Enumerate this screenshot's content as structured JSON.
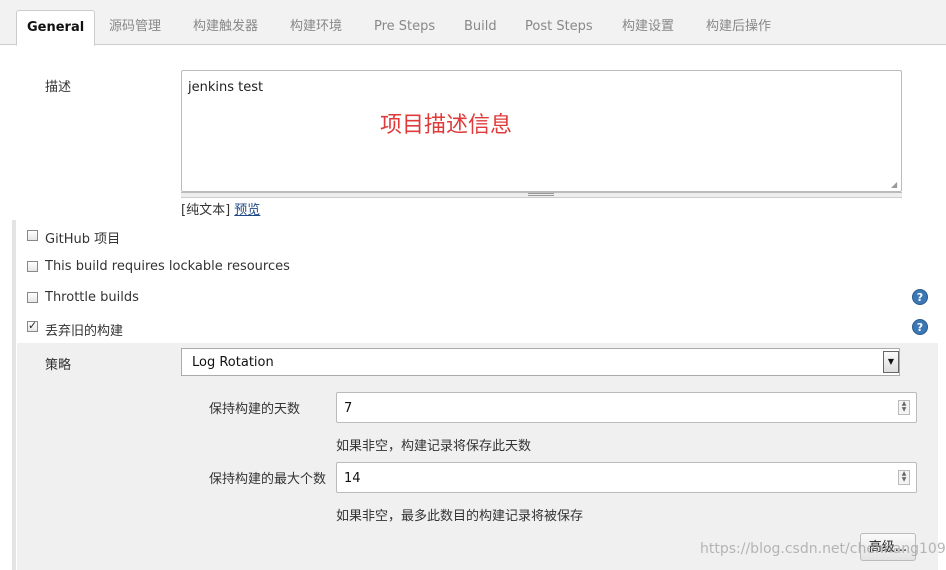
{
  "tabs": [
    {
      "label": "General",
      "active": true
    },
    {
      "label": "源码管理"
    },
    {
      "label": "构建触发器"
    },
    {
      "label": "构建环境"
    },
    {
      "label": "Pre Steps"
    },
    {
      "label": "Build"
    },
    {
      "label": "Post Steps"
    },
    {
      "label": "构建设置"
    },
    {
      "label": "构建后操作"
    }
  ],
  "description": {
    "label": "描述",
    "value": "jenkins test",
    "overlay_note": "项目描述信息",
    "format_prefix": "[纯文本]",
    "preview_link": "预览"
  },
  "options": [
    {
      "label": "GitHub 项目",
      "checked": false
    },
    {
      "label": "This build requires lockable resources",
      "checked": false
    },
    {
      "label": "Throttle builds",
      "checked": false,
      "help": true
    },
    {
      "label": "丢弃旧的构建",
      "checked": true,
      "help": true
    }
  ],
  "strategy": {
    "label": "策略",
    "selected": "Log Rotation"
  },
  "days_to_keep": {
    "label": "保持构建的天数",
    "value": "7",
    "hint": "如果非空，构建记录将保存此天数"
  },
  "max_builds": {
    "label": "保持构建的最大个数",
    "value": "14",
    "hint": "如果非空，最多此数目的构建记录将被保存"
  },
  "advanced_button": "高级...",
  "watermark": "https://blog.csdn.net/chenhang109",
  "icons": {
    "help": "help-icon",
    "dropdown": "chevron-down-icon",
    "spinner": "spinner-icon"
  },
  "colors": {
    "overlay_note": "#e03b3b",
    "help_icon": "#3c78b5",
    "link": "#204a87"
  }
}
